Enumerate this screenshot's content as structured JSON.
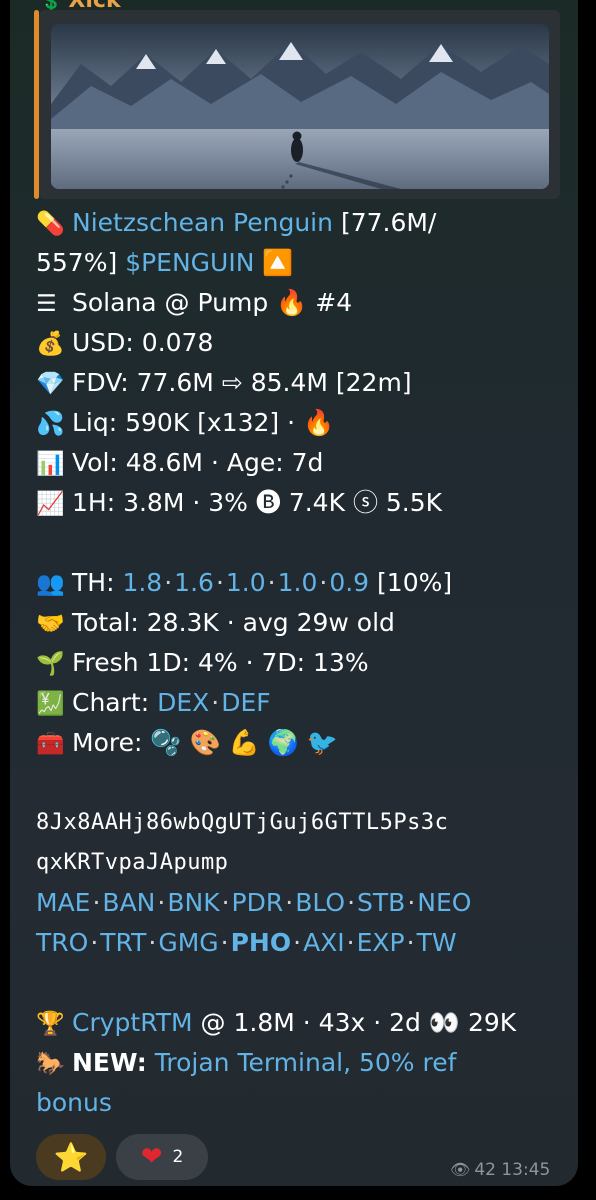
{
  "sender": {
    "name": "Xick",
    "icon": "dollar-coin-icon"
  },
  "token": {
    "name": "Nietzschean Penguin",
    "stat": "[77.6M/",
    "stat2": "557%]",
    "ticker": "$PENGUIN"
  },
  "lines": {
    "chain": "Solana @ Pump",
    "rank": "#4",
    "usd": "USD: 0.078",
    "fdv_label": "FDV: 77.6M",
    "fdv_target": "85.4M [22m]",
    "liq": "Liq: 590K [x132] ·",
    "vol_age": "Vol: 48.6M · Age: 7d",
    "h1": "1H: 3.8M · 3%",
    "h1_b": "7.4K",
    "h1_s": "5.5K",
    "th_label": "TH:",
    "th_values": [
      "1.8",
      "1.6",
      "1.0",
      "1.0",
      "0.9"
    ],
    "th_pct": "[10%]",
    "total": "Total: 28.3K · avg 29w old",
    "fresh": "Fresh 1D: 4% · 7D: 13%",
    "chart_label": "Chart:",
    "chart_links": [
      "DEX",
      "DEF"
    ],
    "more_label": "More:"
  },
  "contract": {
    "line1": "8Jx8AAHj86wbQgUTjGuj6GTTL5Ps3c",
    "line2": "qxKRTvpaJApump"
  },
  "bots_row1": [
    "MAE",
    "BAN",
    "BNK",
    "PDR",
    "BLO",
    "STB",
    "NEO"
  ],
  "bots_row2": [
    "TRO",
    "TRT",
    "GMG",
    "PHO",
    "AXI",
    "EXP",
    "TW"
  ],
  "footer": {
    "trophy_link": "CryptRTM",
    "trophy_stats": "@ 1.8M · 43x · 2d",
    "trophy_eyes": "29K",
    "new_label": "NEW:",
    "new_link_a": "Trojan Terminal, 50% ref",
    "new_link_b": "bonus"
  },
  "reactions": {
    "heart_count": "2"
  },
  "meta": {
    "views": "42",
    "time": "13:45"
  },
  "colors": {
    "link": "#62b3e6",
    "reply_bar": "#e08a2c",
    "sender": "#e8a24a"
  }
}
